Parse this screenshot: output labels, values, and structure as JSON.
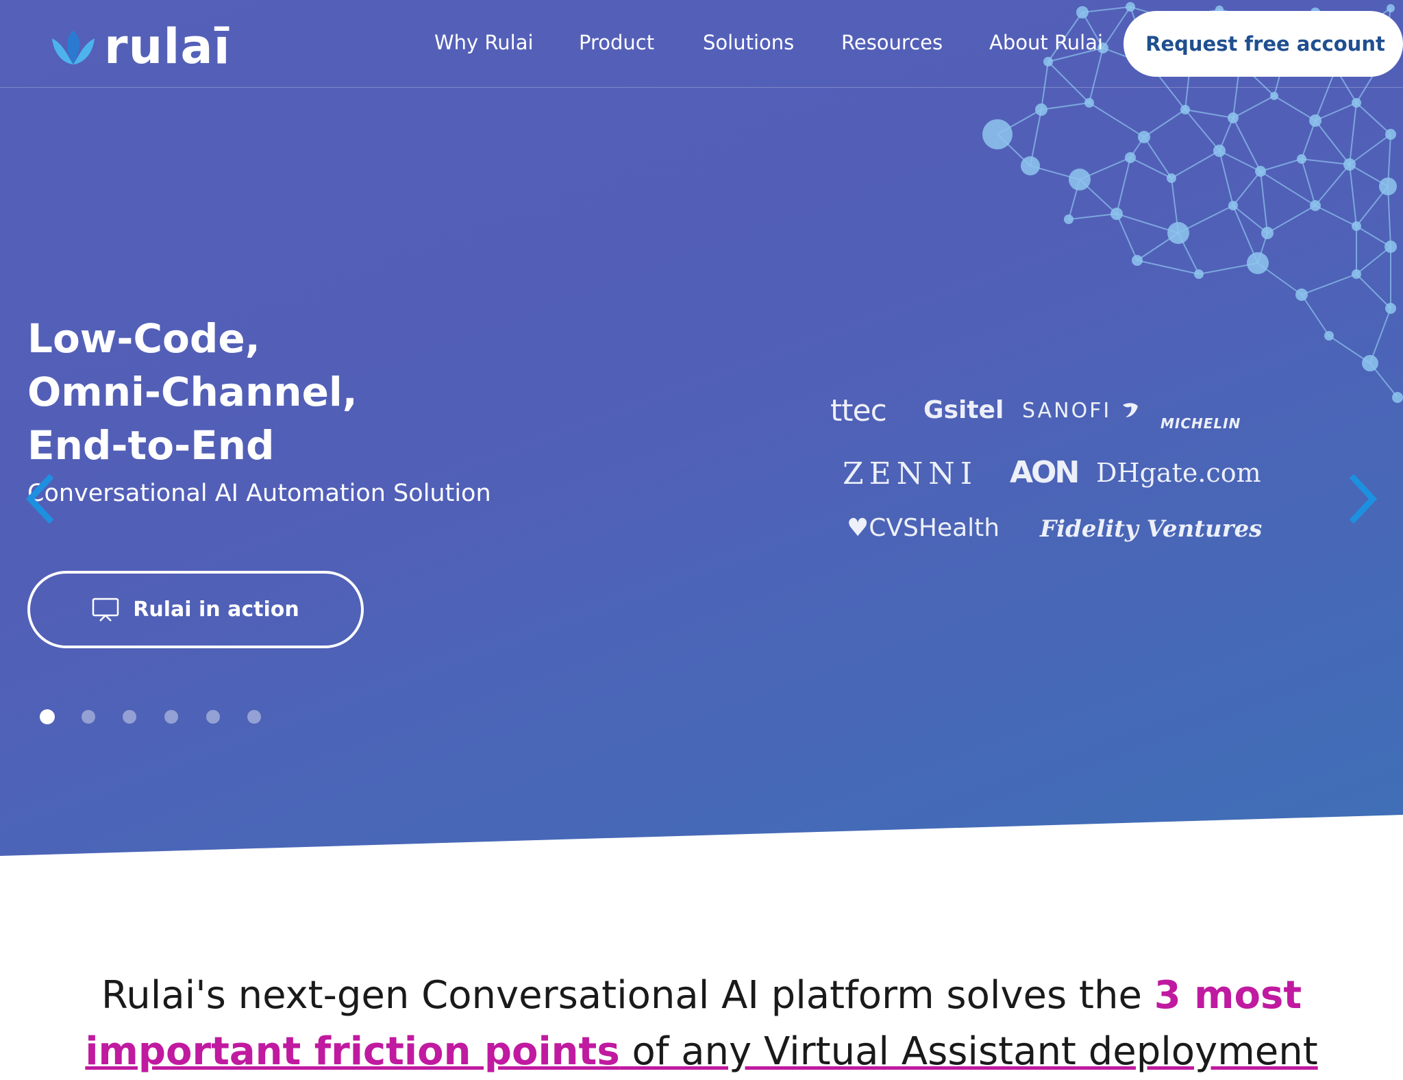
{
  "brand": {
    "name": "rulaī"
  },
  "nav": {
    "items": [
      {
        "label": "Why Rulai"
      },
      {
        "label": "Product"
      },
      {
        "label": "Solutions"
      },
      {
        "label": "Resources"
      },
      {
        "label": "About Rulai"
      }
    ],
    "cta_label": "Request free account"
  },
  "hero": {
    "headline": [
      "Low-Code,",
      "Omni-Channel,",
      "End-to-End"
    ],
    "subheadline": "Conversational AI Automation Solution",
    "action_label": "Rulai in action",
    "action_icon": "monitor-icon",
    "slides_total": 6,
    "active_slide": 1,
    "prev_icon": "chevron-left-icon",
    "next_icon": "chevron-right-icon"
  },
  "client_logos": [
    "ttec",
    "sitel",
    "SANOFI",
    "MICHELIN",
    "ZENNI",
    "AON",
    "DHgate.com",
    "CVSHealth",
    "Fidelity Ventures"
  ],
  "tagline": {
    "prefix": "Rulai's next-gen Conversational AI platform solves the ",
    "accent": "3 most",
    "line2_accent": "important friction points",
    "line2_suffix": " of any Virtual Assistant deployment"
  },
  "colors": {
    "hero_bg": "#525fb7",
    "cta_text": "#1f4f8f",
    "accent": "#c01aa0",
    "arrow": "#1e90e0",
    "network": "#8ec6ee"
  }
}
